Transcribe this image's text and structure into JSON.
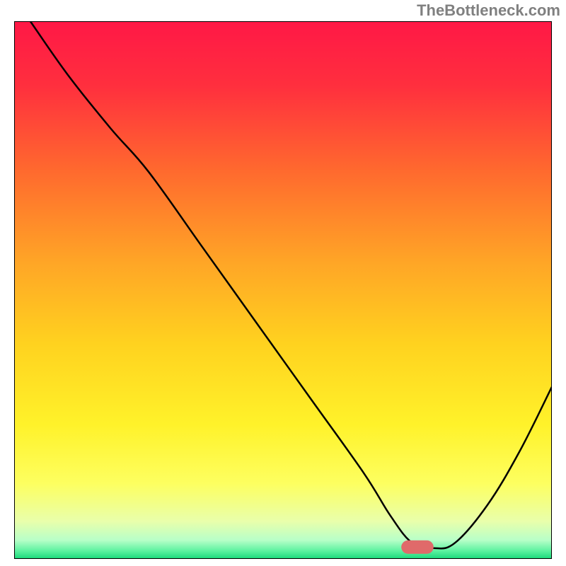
{
  "watermark": "TheBottleneck.com",
  "chart_data": {
    "type": "line",
    "title": "",
    "xlabel": "",
    "ylabel": "",
    "xlim": [
      0,
      100
    ],
    "ylim": [
      0,
      100
    ],
    "grid": false,
    "legend": false,
    "series": [
      {
        "name": "curve",
        "x": [
          3,
          10,
          18,
          25,
          35,
          45,
          55,
          65,
          70,
          74,
          78,
          82,
          88,
          94,
          100
        ],
        "y": [
          100,
          90,
          80,
          72,
          58,
          44,
          30,
          16,
          8,
          3,
          2,
          3,
          10,
          20,
          32
        ]
      }
    ],
    "marker": {
      "x": 75,
      "y": 2.2,
      "color": "#e06a6a",
      "width": 6,
      "height": 2.5
    },
    "background_gradient": {
      "stops": [
        {
          "offset": 0.0,
          "color": "#ff1846"
        },
        {
          "offset": 0.12,
          "color": "#ff2f3e"
        },
        {
          "offset": 0.28,
          "color": "#ff6a2e"
        },
        {
          "offset": 0.45,
          "color": "#ffa626"
        },
        {
          "offset": 0.6,
          "color": "#ffd21f"
        },
        {
          "offset": 0.75,
          "color": "#fff22a"
        },
        {
          "offset": 0.86,
          "color": "#fdff60"
        },
        {
          "offset": 0.93,
          "color": "#e9ffab"
        },
        {
          "offset": 0.965,
          "color": "#b8ffc8"
        },
        {
          "offset": 0.985,
          "color": "#5cf2a0"
        },
        {
          "offset": 1.0,
          "color": "#18d87a"
        }
      ]
    }
  }
}
